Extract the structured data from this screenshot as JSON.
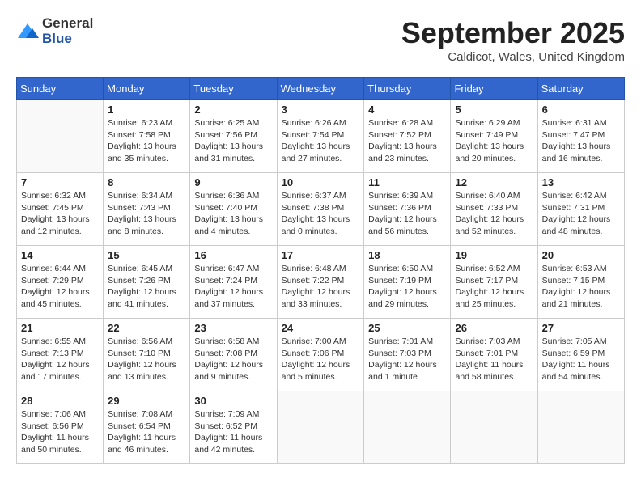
{
  "header": {
    "logo_general": "General",
    "logo_blue": "Blue",
    "month": "September 2025",
    "location": "Caldicot, Wales, United Kingdom"
  },
  "days_of_week": [
    "Sunday",
    "Monday",
    "Tuesday",
    "Wednesday",
    "Thursday",
    "Friday",
    "Saturday"
  ],
  "weeks": [
    [
      {
        "day": "",
        "info": ""
      },
      {
        "day": "1",
        "info": "Sunrise: 6:23 AM\nSunset: 7:58 PM\nDaylight: 13 hours\nand 35 minutes."
      },
      {
        "day": "2",
        "info": "Sunrise: 6:25 AM\nSunset: 7:56 PM\nDaylight: 13 hours\nand 31 minutes."
      },
      {
        "day": "3",
        "info": "Sunrise: 6:26 AM\nSunset: 7:54 PM\nDaylight: 13 hours\nand 27 minutes."
      },
      {
        "day": "4",
        "info": "Sunrise: 6:28 AM\nSunset: 7:52 PM\nDaylight: 13 hours\nand 23 minutes."
      },
      {
        "day": "5",
        "info": "Sunrise: 6:29 AM\nSunset: 7:49 PM\nDaylight: 13 hours\nand 20 minutes."
      },
      {
        "day": "6",
        "info": "Sunrise: 6:31 AM\nSunset: 7:47 PM\nDaylight: 13 hours\nand 16 minutes."
      }
    ],
    [
      {
        "day": "7",
        "info": "Sunrise: 6:32 AM\nSunset: 7:45 PM\nDaylight: 13 hours\nand 12 minutes."
      },
      {
        "day": "8",
        "info": "Sunrise: 6:34 AM\nSunset: 7:43 PM\nDaylight: 13 hours\nand 8 minutes."
      },
      {
        "day": "9",
        "info": "Sunrise: 6:36 AM\nSunset: 7:40 PM\nDaylight: 13 hours\nand 4 minutes."
      },
      {
        "day": "10",
        "info": "Sunrise: 6:37 AM\nSunset: 7:38 PM\nDaylight: 13 hours\nand 0 minutes."
      },
      {
        "day": "11",
        "info": "Sunrise: 6:39 AM\nSunset: 7:36 PM\nDaylight: 12 hours\nand 56 minutes."
      },
      {
        "day": "12",
        "info": "Sunrise: 6:40 AM\nSunset: 7:33 PM\nDaylight: 12 hours\nand 52 minutes."
      },
      {
        "day": "13",
        "info": "Sunrise: 6:42 AM\nSunset: 7:31 PM\nDaylight: 12 hours\nand 48 minutes."
      }
    ],
    [
      {
        "day": "14",
        "info": "Sunrise: 6:44 AM\nSunset: 7:29 PM\nDaylight: 12 hours\nand 45 minutes."
      },
      {
        "day": "15",
        "info": "Sunrise: 6:45 AM\nSunset: 7:26 PM\nDaylight: 12 hours\nand 41 minutes."
      },
      {
        "day": "16",
        "info": "Sunrise: 6:47 AM\nSunset: 7:24 PM\nDaylight: 12 hours\nand 37 minutes."
      },
      {
        "day": "17",
        "info": "Sunrise: 6:48 AM\nSunset: 7:22 PM\nDaylight: 12 hours\nand 33 minutes."
      },
      {
        "day": "18",
        "info": "Sunrise: 6:50 AM\nSunset: 7:19 PM\nDaylight: 12 hours\nand 29 minutes."
      },
      {
        "day": "19",
        "info": "Sunrise: 6:52 AM\nSunset: 7:17 PM\nDaylight: 12 hours\nand 25 minutes."
      },
      {
        "day": "20",
        "info": "Sunrise: 6:53 AM\nSunset: 7:15 PM\nDaylight: 12 hours\nand 21 minutes."
      }
    ],
    [
      {
        "day": "21",
        "info": "Sunrise: 6:55 AM\nSunset: 7:13 PM\nDaylight: 12 hours\nand 17 minutes."
      },
      {
        "day": "22",
        "info": "Sunrise: 6:56 AM\nSunset: 7:10 PM\nDaylight: 12 hours\nand 13 minutes."
      },
      {
        "day": "23",
        "info": "Sunrise: 6:58 AM\nSunset: 7:08 PM\nDaylight: 12 hours\nand 9 minutes."
      },
      {
        "day": "24",
        "info": "Sunrise: 7:00 AM\nSunset: 7:06 PM\nDaylight: 12 hours\nand 5 minutes."
      },
      {
        "day": "25",
        "info": "Sunrise: 7:01 AM\nSunset: 7:03 PM\nDaylight: 12 hours\nand 1 minute."
      },
      {
        "day": "26",
        "info": "Sunrise: 7:03 AM\nSunset: 7:01 PM\nDaylight: 11 hours\nand 58 minutes."
      },
      {
        "day": "27",
        "info": "Sunrise: 7:05 AM\nSunset: 6:59 PM\nDaylight: 11 hours\nand 54 minutes."
      }
    ],
    [
      {
        "day": "28",
        "info": "Sunrise: 7:06 AM\nSunset: 6:56 PM\nDaylight: 11 hours\nand 50 minutes."
      },
      {
        "day": "29",
        "info": "Sunrise: 7:08 AM\nSunset: 6:54 PM\nDaylight: 11 hours\nand 46 minutes."
      },
      {
        "day": "30",
        "info": "Sunrise: 7:09 AM\nSunset: 6:52 PM\nDaylight: 11 hours\nand 42 minutes."
      },
      {
        "day": "",
        "info": ""
      },
      {
        "day": "",
        "info": ""
      },
      {
        "day": "",
        "info": ""
      },
      {
        "day": "",
        "info": ""
      }
    ]
  ]
}
